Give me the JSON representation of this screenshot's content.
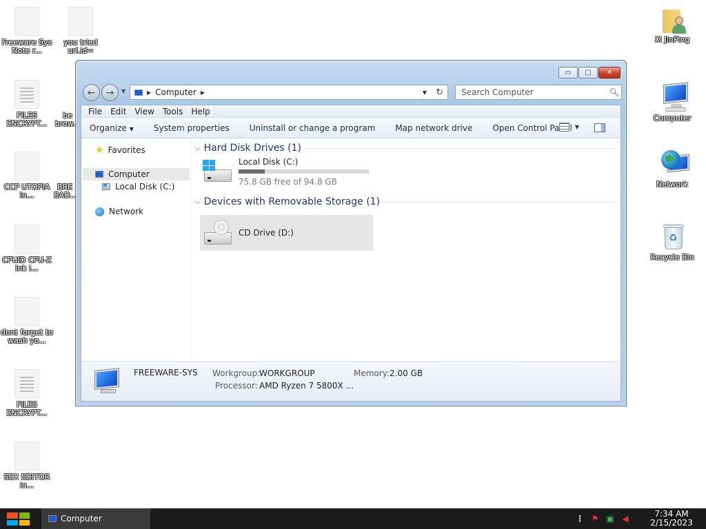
{
  "desktop": {
    "left_icons": [
      {
        "label": "Freeware Sys Note r..."
      },
      {
        "label": "you tried url.id="
      },
      {
        "label": "FILES ENCRYPT..."
      },
      {
        "label": "be brow..."
      },
      {
        "label": "CCP UTOPIA In..."
      },
      {
        "label": "BRE BAD..."
      },
      {
        "label": "CPUID CPU-Z lnk i..."
      },
      {
        "label": "dont forget to wash yo..."
      },
      {
        "label": "FILES ENCRYPT..."
      },
      {
        "label": "SEX EDITOR in..."
      }
    ],
    "right_icons": [
      {
        "label": "Xi JinPing",
        "icon": "user-folder-icon"
      },
      {
        "label": "Computer",
        "icon": "computer-icon"
      },
      {
        "label": "Network",
        "icon": "network-icon"
      },
      {
        "label": "Recycle Bin",
        "icon": "recycle-bin-icon"
      }
    ]
  },
  "window": {
    "caption_buttons": {
      "minimize": "▭",
      "maximize": "▢",
      "close": "✕"
    },
    "address": {
      "crumb": "Computer"
    },
    "search": {
      "placeholder": "Search Computer"
    },
    "menu": [
      "File",
      "Edit",
      "View",
      "Tools",
      "Help"
    ],
    "commands": {
      "organize": "Organize",
      "system_properties": "System properties",
      "uninstall": "Uninstall or change a program",
      "map_drive": "Map network drive",
      "control_panel": "Open Control Panel"
    },
    "nav_pane": {
      "favorites": "Favorites",
      "computer": "Computer",
      "local_disk": "Local Disk (C:)",
      "network": "Network"
    },
    "groups": {
      "hdd": "Hard Disk Drives (1)",
      "removable": "Devices with Removable Storage (1)"
    },
    "drives": {
      "c": {
        "name": "Local Disk (C:)",
        "free_text": "75.8 GB free of 94.8 GB",
        "used_fraction": 0.2
      },
      "d": {
        "name": "CD Drive (D:)"
      }
    },
    "details": {
      "computer_name": "FREEWARE-SYS",
      "workgroup_label": "Workgroup:",
      "workgroup_value": "WORKGROUP",
      "memory_label": "Memory:",
      "memory_value": "2.00 GB",
      "processor_label": "Processor:",
      "processor_value": "AMD Ryzen 7 5800X ..."
    }
  },
  "taskbar": {
    "task_label": "Computer",
    "time": "7:34 AM",
    "date": "2/15/2023",
    "start_colors": [
      "#f25022",
      "#7fba00",
      "#00a4ef",
      "#ffb900"
    ]
  }
}
